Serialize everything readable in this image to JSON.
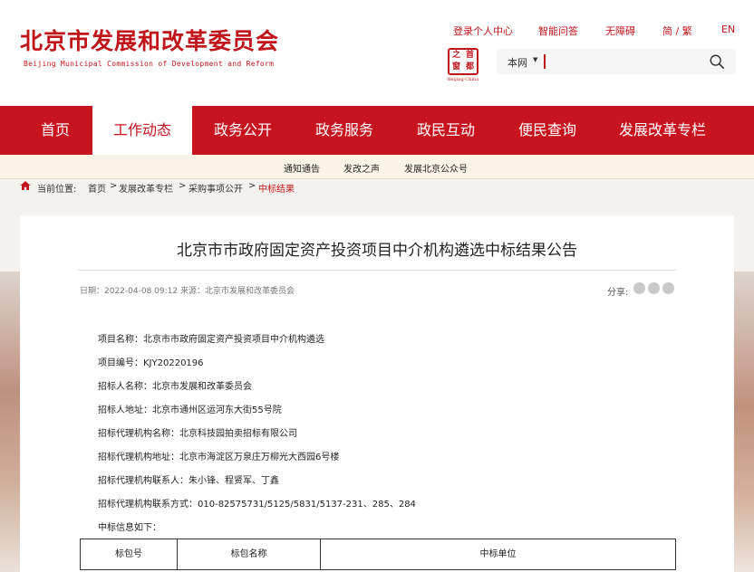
{
  "header": {
    "logo_cn": "北京市发展和改革委员会",
    "logo_en": "Beijing Municipal Commission of Development and Reform",
    "top_links": [
      "登录个人中心",
      "智能问答",
      "无障碍",
      "简 / 繁",
      "EN"
    ],
    "seal_chars": [
      "之",
      "首",
      "窗",
      "都"
    ],
    "seal_sub": "Beijing·China",
    "search": {
      "scope": "本网",
      "placeholder": ""
    }
  },
  "nav": {
    "items": [
      "首页",
      "工作动态",
      "政务公开",
      "政务服务",
      "政民互动",
      "便民查询",
      "发展改革专栏"
    ],
    "active_index": 1
  },
  "subnav": {
    "items": [
      "通知通告",
      "发改之声",
      "发展北京公众号"
    ]
  },
  "breadcrumb": {
    "label": "当前位置:",
    "items": [
      "首页",
      "发展改革专栏",
      "采购事项公开",
      "中标结果"
    ],
    "separator": ">"
  },
  "article": {
    "title": "北京市市政府固定资产投资项目中介机构遴选中标结果公告",
    "meta": "日期：2022-04-08 09:12 来源：北京市发展和改革委员会",
    "share_label": "分享:",
    "fields": [
      "项目名称：北京市市政府固定资产投资项目中介机构遴选",
      "项目编号：KJY20220196",
      "招标人名称：北京市发展和改革委员会",
      "招标人地址：北京市通州区运河东大街55号院",
      "招标代理机构名称：北京科技园拍卖招标有限公司",
      "招标代理机构地址：北京市海淀区万泉庄万柳光大西园6号楼",
      "招标代理机构联系人：朱小锋、程贤军、丁鑫",
      "招标代理机构联系方式：010-82575731/5125/5831/5137-231、285、284",
      "中标信息如下："
    ],
    "table_headers": [
      "标包号",
      "标包名称",
      "中标单位"
    ]
  },
  "colors": {
    "brand_red": "#c8141f",
    "subnav_bg": "#fbf3e6"
  }
}
